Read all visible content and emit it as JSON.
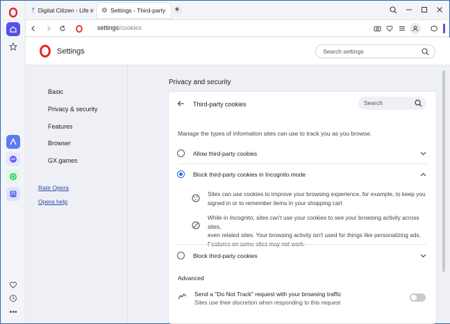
{
  "colors": {
    "opera_red": "#e6232b",
    "accent": "#1f6dd9",
    "active_sidebar": "#5650e8"
  },
  "tabs": [
    {
      "label": "Digital Citizen - Life in a d",
      "icon": "digital-citizen-icon"
    },
    {
      "label": "Settings - Third-party coo",
      "icon": "gear-icon"
    }
  ],
  "address_bar": {
    "host": "settings",
    "path": "/cookies"
  },
  "header": {
    "title": "Settings",
    "search_placeholder": "Search settings"
  },
  "left_nav": {
    "items": [
      "Basic",
      "Privacy & security",
      "Features",
      "Browser",
      "GX.games"
    ],
    "links": [
      "Rate Opera",
      "Opera help"
    ]
  },
  "main": {
    "section_title": "Privacy and security",
    "card_title": "Third-party cookies",
    "search_placeholder": "Search",
    "description": "Manage the types of information sites can use to track you as you browse.",
    "options": [
      {
        "label": "Allow third-party cookies",
        "selected": false,
        "expanded": false
      },
      {
        "label": "Block third-party cookies in Incognito mode",
        "selected": true,
        "expanded": true
      },
      {
        "label": "Block third-party cookies",
        "selected": false,
        "expanded": false
      }
    ],
    "details": [
      {
        "icon": "cookie-icon",
        "line1": "Sites can use cookies to improve your browsing experience, for example, to keep you",
        "line2": "signed in or to remember items in your shopping cart"
      },
      {
        "icon": "block-icon",
        "line1": "While in Incognito, sites can't use your cookies to see your browsing activity across sites,",
        "line2": "even related sites. Your browsing activity isn't used for things like personalizing ads.",
        "line3": "Features on some sites may not work."
      }
    ],
    "advanced_title": "Advanced",
    "dnt": {
      "label": "Send a \"Do Not Track\" request with your browsing traffic",
      "sub": "Sites use their discretion when responding to this request",
      "enabled": false
    }
  }
}
